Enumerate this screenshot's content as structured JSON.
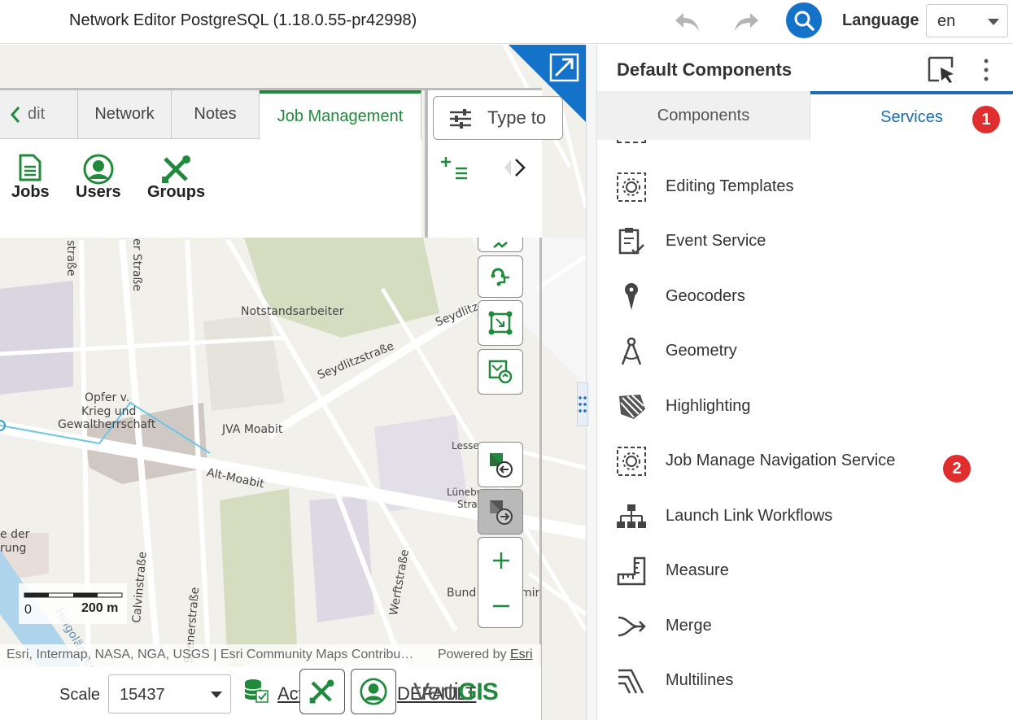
{
  "header": {
    "title": "Network Editor PostgreSQL (1.18.0.55-pr42998)",
    "language_label": "Language",
    "language_value": "en",
    "icons": [
      "undo-icon",
      "redo-icon",
      "search-icon"
    ]
  },
  "ribbon": {
    "tabs": [
      "dit",
      "Network",
      "Notes",
      "Job Management"
    ],
    "active_tab": "Job Management",
    "buttons": [
      "Jobs",
      "Users",
      "Groups"
    ],
    "search_placeholder": "Type to"
  },
  "map": {
    "labels": {
      "strasse1": "straße",
      "strasse2": "er Straße",
      "notstand": "Notstandsarbeiter",
      "seydlitz": "Seydlitzstraße",
      "seydlitz2": "Seydlitz",
      "opfer1": "Opfer v.",
      "opfer2": "Krieg und",
      "opfer3": "Gewaltherrschaft",
      "jva": "JVA Moabit",
      "altmoabit": "Alt-Moabit",
      "lesse": "Lesse",
      "lune1": "Lünebu",
      "lune2": "Stra",
      "der1": "e der",
      "der2": "rung",
      "calvin": "Calvinstraße",
      "spener": "Spenerstraße",
      "werft": "Werftstraße",
      "bund": "Bund",
      "mir": "mir",
      "helgo": "Helgoländer"
    },
    "scalebar": {
      "zero": "0",
      "distance": "200 m"
    },
    "attribution": "Esri, Intermap, NASA, NGA, USGS | Esri Community Maps Contribu…",
    "powered_by": "Powered by",
    "powered_by_link": "Esri"
  },
  "bottom": {
    "scale_label": "Scale",
    "scale_value": "15437",
    "active_label": "Acti",
    "active_suffix": "DEFAULT",
    "brand_a": "Verti",
    "brand_b": "GIS"
  },
  "panel": {
    "title": "Default Components",
    "tabs": [
      "Components",
      "Services"
    ],
    "active_tab": "Services",
    "badge_1": "1",
    "badge_2": "2",
    "services": [
      {
        "name": "Editing Templates",
        "icon": "gear-dashed-icon"
      },
      {
        "name": "Event Service",
        "icon": "clipboard-check-icon"
      },
      {
        "name": "Geocoders",
        "icon": "map-pin-icon"
      },
      {
        "name": "Geometry",
        "icon": "compass-icon"
      },
      {
        "name": "Highlighting",
        "icon": "highlight-shape-icon"
      },
      {
        "name": "Job Manage Navigation Service",
        "icon": "gear-dashed-icon"
      },
      {
        "name": "Launch Link Workflows",
        "icon": "org-chart-icon"
      },
      {
        "name": "Measure",
        "icon": "ruler-icon"
      },
      {
        "name": "Merge",
        "icon": "merge-arrow-icon"
      },
      {
        "name": "Multilines",
        "icon": "multilines-icon"
      }
    ]
  },
  "colors": {
    "brand_green": "#1f8a3b",
    "accent_blue": "#1473c8",
    "badge_red": "#e02d2d"
  }
}
